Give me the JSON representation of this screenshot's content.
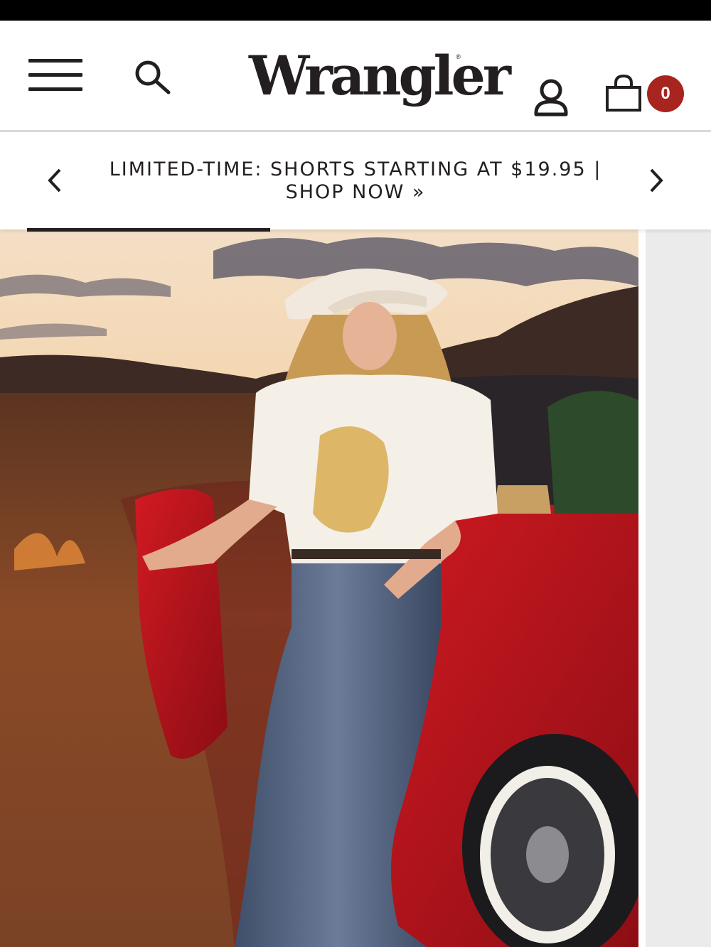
{
  "header": {
    "brand": "Wrangler",
    "cart_count": "0",
    "icons": {
      "menu": "hamburger-menu-icon",
      "search": "search-icon",
      "account": "user-account-icon",
      "cart": "shopping-bag-icon"
    }
  },
  "promo": {
    "text": "LIMITED-TIME: SHORTS STARTING AT $19.95 | SHOP NOW »",
    "prev_icon": "chevron-left-icon",
    "next_icon": "chevron-right-icon"
  },
  "hero": {
    "image": "model-in-cowboy-hat-leaning-on-red-convertible"
  },
  "colors": {
    "brand_text": "#231f20",
    "badge": "#a8241f",
    "divider": "#d9d9d9",
    "side_panel": "#ebebeb"
  }
}
